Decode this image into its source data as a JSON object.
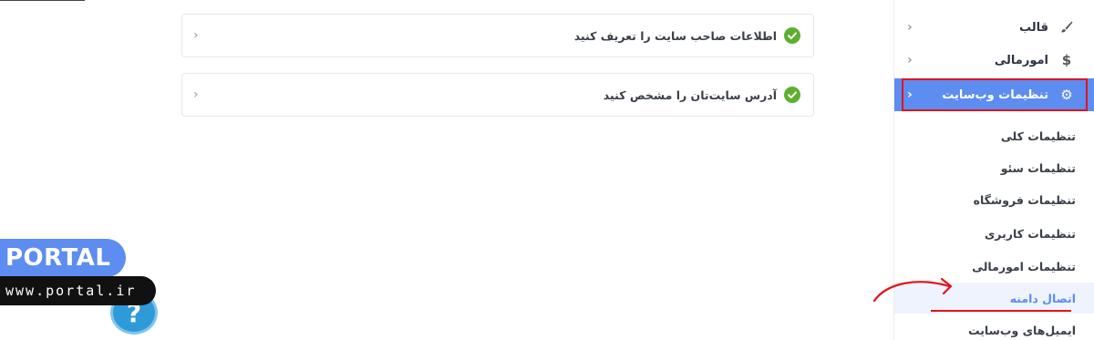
{
  "sidebar": {
    "items": [
      {
        "label": "قالب",
        "icon": "brush-icon"
      },
      {
        "label": "امورمالی",
        "icon": "dollar-icon"
      },
      {
        "label": "تنظیمات وب‌سایت",
        "icon": "gear-icon",
        "active": true
      }
    ],
    "sub_items": [
      {
        "label": "تنظیمات کلی"
      },
      {
        "label": "تنظیمات سئو"
      },
      {
        "label": "تنظیمات فروشگاه"
      },
      {
        "label": "تنظیمات کاربری"
      },
      {
        "label": "تنظیمات امورمالی"
      },
      {
        "label": "اتصال دامنه",
        "selected": true
      },
      {
        "label": "ایمیل‌های وب‌سایت"
      }
    ]
  },
  "main": {
    "cards": [
      {
        "label": "اطلاعات صاحب سایت را تعریف کنید",
        "status": "done"
      },
      {
        "label": "آدرس سایت‌تان را مشخص کنید",
        "status": "done"
      }
    ]
  },
  "watermark": {
    "brand": "PORTAL",
    "url": "www.portal.ir"
  },
  "help": {
    "symbol": "?"
  },
  "colors": {
    "accent": "#5d8df0",
    "highlight_red": "#e3131b",
    "success_green": "#5cb030"
  }
}
